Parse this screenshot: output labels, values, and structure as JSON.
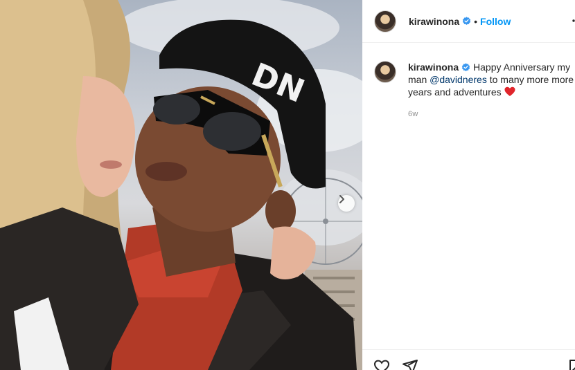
{
  "post": {
    "author": {
      "username": "kirawinona",
      "verified": true,
      "avatar_icon": "profile-avatar"
    },
    "header": {
      "separator": "•",
      "follow_label": "Follow",
      "more_icon": "more-options-icon"
    },
    "caption": {
      "text_before": "Happy Anniversary my man ",
      "mention": "@davidneres",
      "text_after": " to many more more years and adventures ",
      "emoji": "red-heart"
    },
    "time_ago": "6w",
    "media": {
      "next_icon": "chevron-right-icon",
      "photo_text": "DN"
    },
    "actions": {
      "like_icon": "heart-outline-icon",
      "share_icon": "paper-plane-icon",
      "save_icon": "bookmark-icon"
    },
    "colors": {
      "accent_link": "#0095f6",
      "mention": "#00376b",
      "verified": "#3897f0",
      "heart": "#ed4956"
    }
  }
}
